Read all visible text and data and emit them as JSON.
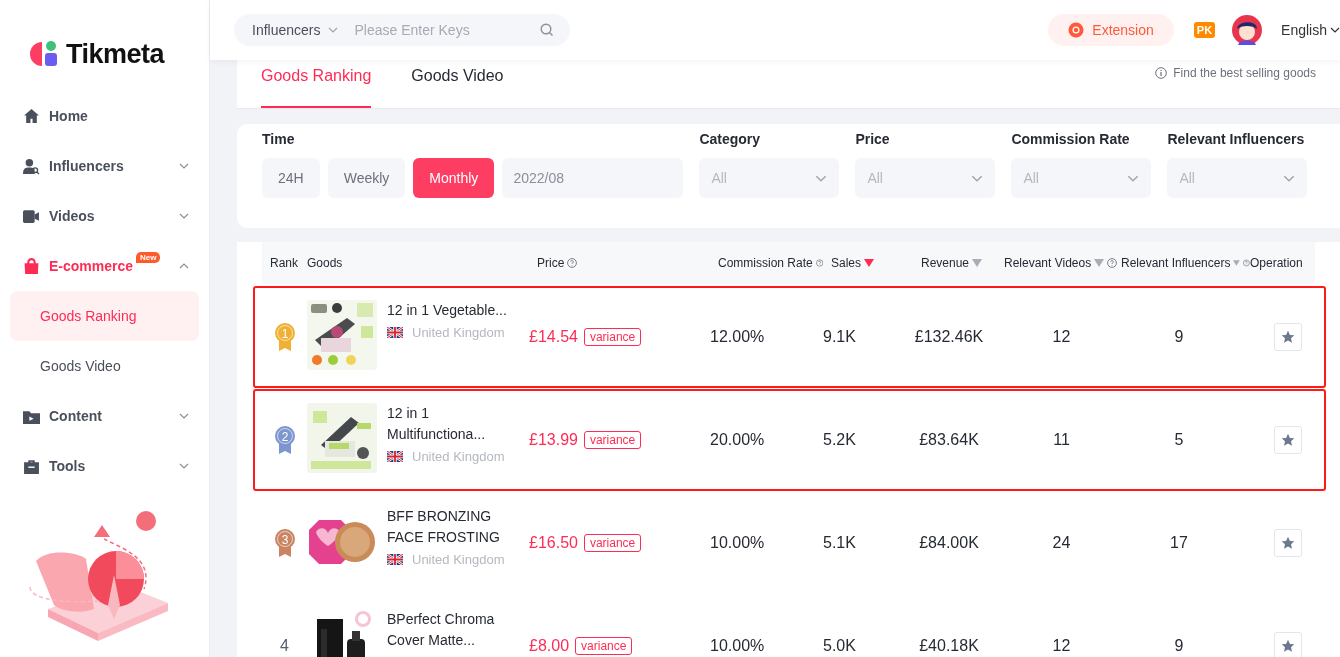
{
  "logo": {
    "name": "Tikmeta"
  },
  "sidebar": {
    "items": [
      {
        "label": "Home",
        "selected": false
      },
      {
        "label": "Influencers",
        "expanded": false,
        "selected": false
      },
      {
        "label": "Videos",
        "expanded": false,
        "selected": false
      },
      {
        "label": "E-commerce",
        "badge": "New",
        "expanded": true,
        "selected": true,
        "children": [
          {
            "label": "Goods Ranking",
            "selected": true
          },
          {
            "label": "Goods Video",
            "selected": false
          }
        ]
      },
      {
        "label": "Content",
        "expanded": false,
        "selected": false
      },
      {
        "label": "Tools",
        "expanded": false,
        "selected": false
      }
    ]
  },
  "header": {
    "search_scope": "Influencers",
    "search": {
      "placeholder": "Please Enter Keys"
    },
    "extension": "Extension",
    "pk": "PK",
    "language": "English"
  },
  "tabs": [
    {
      "label": "Goods Ranking",
      "selected": true
    },
    {
      "label": "Goods Video",
      "selected": false
    }
  ],
  "hint": "Find the best selling goods",
  "filters": {
    "time_label": "Time",
    "time_options": [
      {
        "label": "24H",
        "selected": false
      },
      {
        "label": "Weekly",
        "selected": false
      },
      {
        "label": "Monthly",
        "selected": true
      }
    ],
    "date": "2022/08",
    "selects": [
      {
        "label": "Category",
        "value": "All"
      },
      {
        "label": "Price",
        "value": "All"
      },
      {
        "label": "Commission Rate",
        "value": "All"
      },
      {
        "label": "Relevant Influencers",
        "value": "All"
      }
    ]
  },
  "table": {
    "columns": [
      {
        "label": "Rank",
        "kind": "plain"
      },
      {
        "label": "Goods",
        "kind": "plain"
      },
      {
        "label": "Price",
        "kind": "help"
      },
      {
        "label": "Commission Rate",
        "kind": "help"
      },
      {
        "label": "Sales",
        "kind": "sort",
        "sort_active": true
      },
      {
        "label": "Revenue",
        "kind": "sort",
        "sort_active": false
      },
      {
        "label": "Relevant Videos",
        "kind": "sort_help",
        "sort_active": false
      },
      {
        "label": "Relevant Influencers",
        "kind": "sort_help",
        "sort_active": false
      },
      {
        "label": "Operation",
        "kind": "plain"
      }
    ],
    "rows": [
      {
        "rank": "1",
        "kind": "medal",
        "color": "#f0b033",
        "name": "12 in 1 Vegetable...",
        "country": "United Kingdom",
        "price": "£14.54",
        "tag": "variance",
        "commission": "12.00%",
        "sales": "9.1K",
        "revenue": "£132.46K",
        "videos": "12",
        "influencers": "9",
        "highlighted": true
      },
      {
        "rank": "2",
        "kind": "medal",
        "color": "#7d96cf",
        "name": "12 in 1 Multifunctiona...",
        "country": "United Kingdom",
        "price": "£13.99",
        "tag": "variance",
        "commission": "20.00%",
        "sales": "5.2K",
        "revenue": "£83.64K",
        "videos": "11",
        "influencers": "5",
        "highlighted": true
      },
      {
        "rank": "3",
        "kind": "medal",
        "color": "#c98563",
        "name": "BFF BRONZING FACE FROSTING",
        "country": "United Kingdom",
        "price": "£16.50",
        "tag": "variance",
        "commission": "10.00%",
        "sales": "5.1K",
        "revenue": "£84.00K",
        "videos": "24",
        "influencers": "17",
        "highlighted": false
      },
      {
        "rank": "4",
        "kind": "plain",
        "name": "BPerfect Chroma Cover Matte...",
        "price": "£8.00",
        "tag": "variance",
        "commission": "10.00%",
        "sales": "5.0K",
        "revenue": "£40.18K",
        "videos": "12",
        "influencers": "9",
        "highlighted": false
      }
    ]
  }
}
